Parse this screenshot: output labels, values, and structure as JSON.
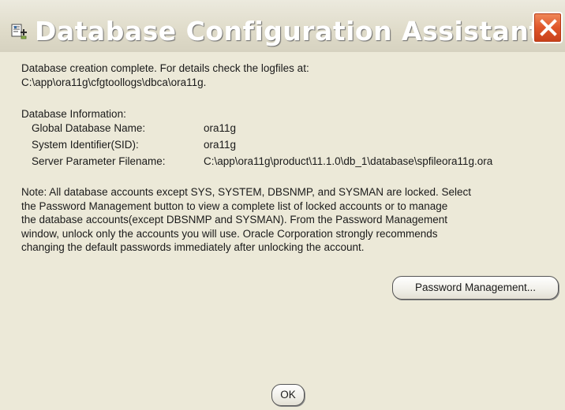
{
  "window": {
    "title": "Database Configuration Assistant",
    "icon": "dbca-app-icon",
    "close_icon": "close-x-icon",
    "accent_color": "#e0562a"
  },
  "message": {
    "line1": "Database creation complete. For details check the logfiles at:",
    "line2": " C:\\app\\ora11g\\cfgtoollogs\\dbca\\ora11g."
  },
  "db_info": {
    "heading": "Database Information:",
    "rows": [
      {
        "label": "Global Database Name:",
        "value": "ora11g"
      },
      {
        "label": "System Identifier(SID):",
        "value": "ora11g"
      },
      {
        "label": "Server Parameter Filename:",
        "value": "C:\\app\\ora11g\\product\\11.1.0\\db_1\\database\\spfileora11g.ora"
      }
    ]
  },
  "note": {
    "lines": [
      "Note: All database accounts except SYS, SYSTEM, DBSNMP, and SYSMAN are locked. Select",
      "the Password Management button to view a complete list of locked accounts or to manage",
      "the database accounts(except DBSNMP and SYSMAN). From the Password Management",
      "window, unlock only the accounts you will use. Oracle Corporation strongly recommends",
      "changing the default passwords immediately after unlocking the account."
    ]
  },
  "buttons": {
    "password_management": "Password Management...",
    "ok": "OK"
  }
}
